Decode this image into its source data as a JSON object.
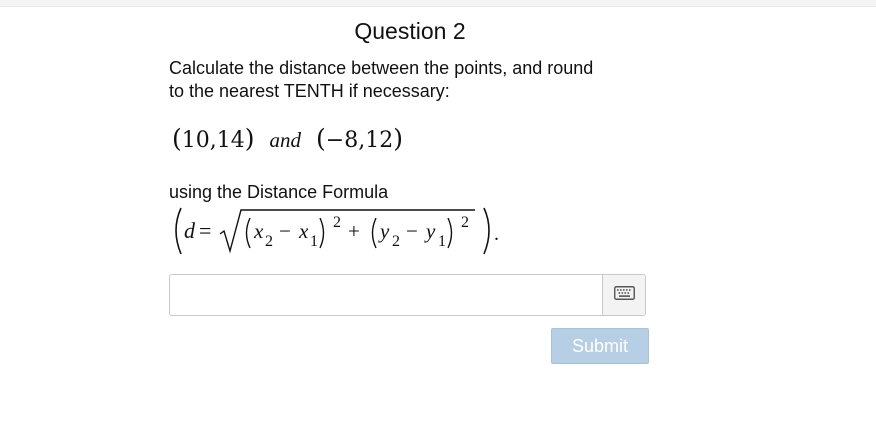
{
  "question": {
    "title": "Question 2",
    "prompt_line1": "Calculate the distance between the points, and round",
    "prompt_line2": "to the nearest TENTH if necessary:",
    "point1": "10,14",
    "conjunction": "and",
    "point2": "−8,12",
    "formula_intro": "using the Distance Formula",
    "formula": "d = √((x2 − x1)^2 + (y2 − y1)^2)."
  },
  "answer": {
    "value": "",
    "placeholder": ""
  },
  "icons": {
    "keyboard": "keyboard-icon"
  },
  "actions": {
    "submit_label": "Submit"
  },
  "colors": {
    "submit_background": "#b6cfe5",
    "submit_text": "#ffffff",
    "input_border": "#c8c8c8"
  }
}
